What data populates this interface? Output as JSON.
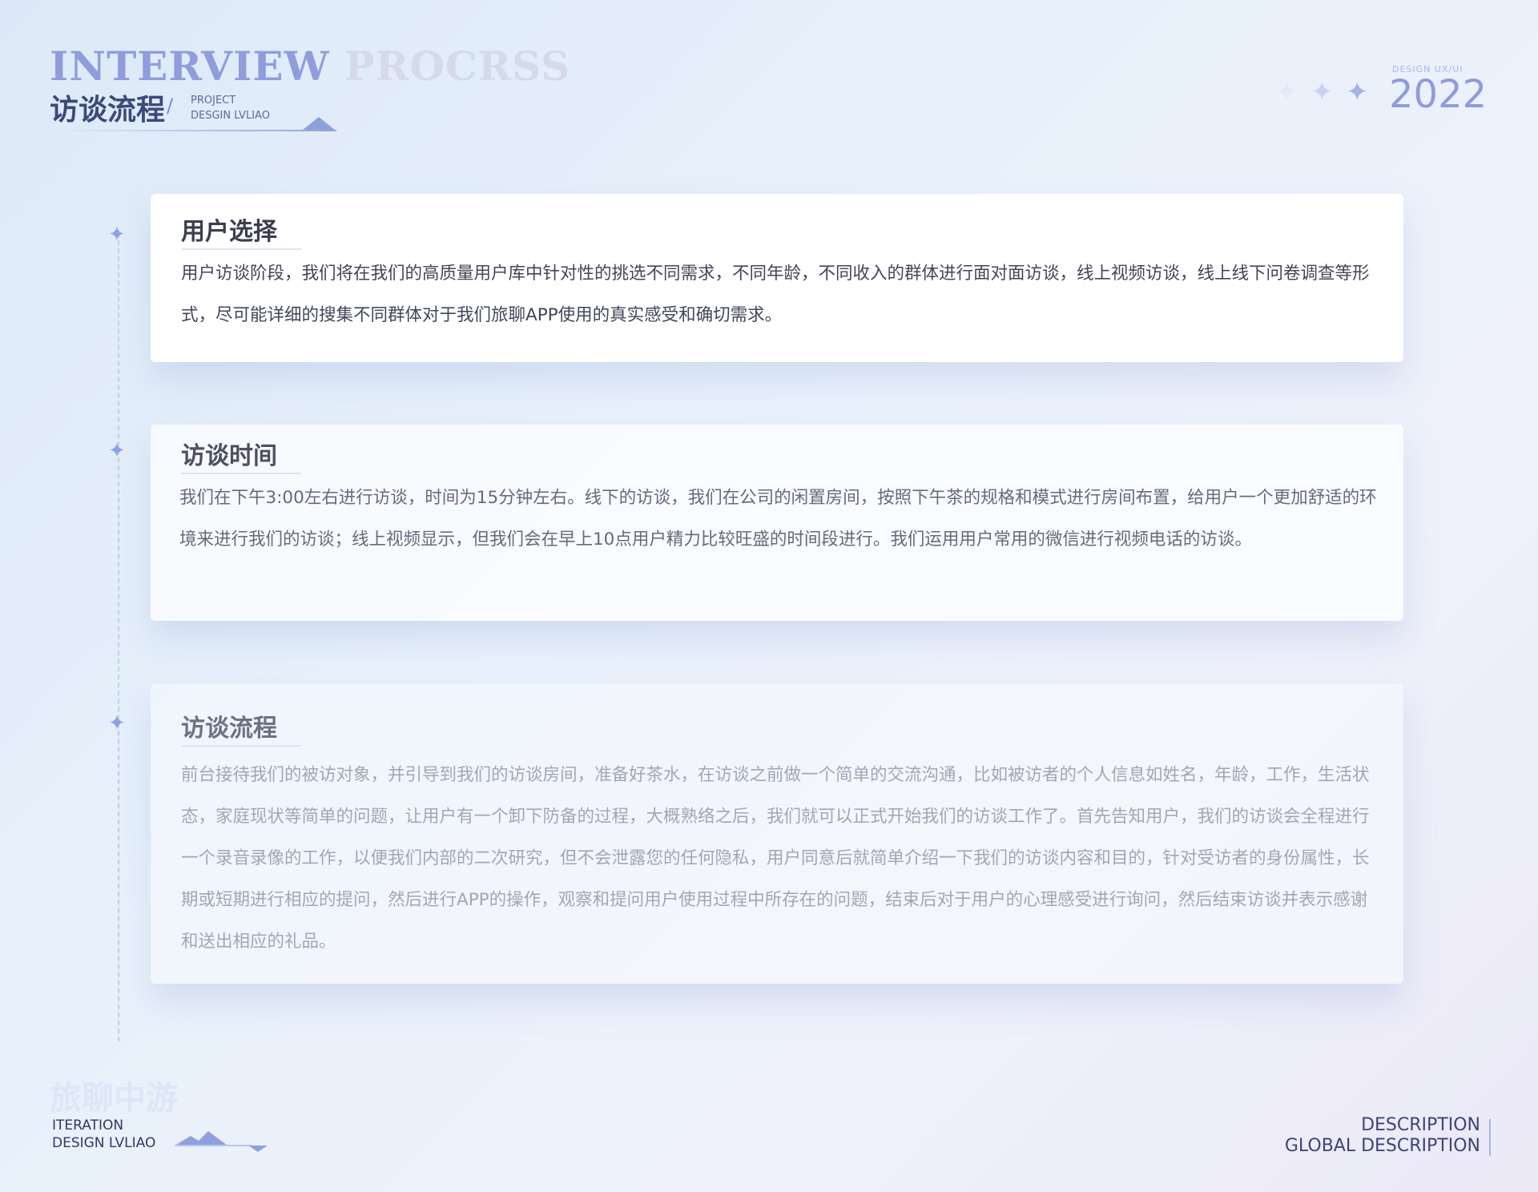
{
  "header": {
    "title_en_part1": "INTERVIEW",
    "title_en_part2": "PROCRSS",
    "title_cn": "访谈流程",
    "slash": "/",
    "project_line1": "PROJECT",
    "project_line2": "DESGIN LVLIAO",
    "year_label": "DESIGN   UX/UI",
    "year": "2022"
  },
  "cards": [
    {
      "title": "用户选择",
      "body": "用户访谈阶段，我们将在我们的高质量用户库中针对性的挑选不同需求，不同年龄，不同收入的群体进行面对面访谈，线上视频访谈，线上线下问卷调查等形式，尽可能详细的搜集不同群体对于我们旅聊APP使用的真实感受和确切需求。"
    },
    {
      "title": "访谈时间",
      "body": "我们在下午3:00左右进行访谈，时间为15分钟左右。线下的访谈，我们在公司的闲置房间，按照下午茶的规格和模式进行房间布置，给用户一个更加舒适的环境来进行我们的访谈；线上视频显示，但我们会在早上10点用户精力比较旺盛的时间段进行。我们运用用户常用的微信进行视频电话的访谈。"
    },
    {
      "title": "访谈流程",
      "body": "前台接待我们的被访对象，并引导到我们的访谈房间，准备好茶水，在访谈之前做一个简单的交流沟通，比如被访者的个人信息如姓名，年龄，工作，生活状态，家庭现状等简单的问题，让用户有一个卸下防备的过程，大概熟络之后，我们就可以正式开始我们的访谈工作了。首先告知用户，我们的访谈会全程进行一个录音录像的工作，以便我们内部的二次研究，但不会泄露您的任何隐私，用户同意后就简单介绍一下我们的访谈内容和目的，针对受访者的身份属性，长期或短期进行相应的提问，然后进行APP的操作，观察和提问用户使用过程中所存在的问题，结束后对于用户的心理感受进行询问，然后结束访谈并表示感谢和送出相应的礼品。"
    }
  ],
  "footer": {
    "brand_cn": "旅聊中游",
    "iteration_line1": "ITERATION",
    "iteration_line2": "DESIGN   LVLIAO",
    "description_line1": "DESCRIPTION",
    "description_line2": "GLOBAL DESCRIPTION"
  },
  "icons": {
    "timeline_marker": "four-point-star-icon",
    "header_decoration": "sparkle-icon",
    "footer_decoration": "mountain-icon"
  },
  "colors": {
    "accent": "#8f9ddc",
    "title_dark": "#3d4a78",
    "background": "#e6eefa"
  }
}
